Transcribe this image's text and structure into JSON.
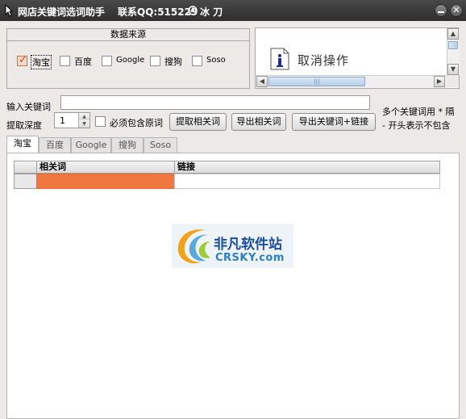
{
  "window": {
    "title": "网店关键词选词助手",
    "contact": "联系QQ:515229",
    "author": "冰 刀"
  },
  "source_group": {
    "title": "数据来源",
    "options": [
      {
        "label": "淘宝",
        "checked": true
      },
      {
        "label": "百度",
        "checked": false
      },
      {
        "label": "Google",
        "checked": false
      },
      {
        "label": "搜狗",
        "checked": false
      },
      {
        "label": "Soso",
        "checked": false
      }
    ]
  },
  "message": {
    "icon": "info-icon",
    "text": "取消操作"
  },
  "form": {
    "keyword_label": "输入关键词",
    "keyword_value": "",
    "depth_label": "提取深度",
    "depth_value": "1",
    "must_contain_label": "必须包含原词",
    "fetch_button": "提取相关词",
    "export_button": "导出相关词",
    "export_links_button": "导出关键词+链接",
    "hint_line1": "多个关键词用 * 隔",
    "hint_line2": "- 开头表示不包含"
  },
  "tabs": [
    "淘宝",
    "百度",
    "Google",
    "搜狗",
    "Soso"
  ],
  "grid": {
    "columns": [
      "相关词",
      "链接"
    ]
  },
  "watermark": {
    "line1": "非凡软件站",
    "line2": "CRSKY.com"
  },
  "colors": {
    "accent": "#f07840",
    "titlebar": "#3a3a3a"
  }
}
